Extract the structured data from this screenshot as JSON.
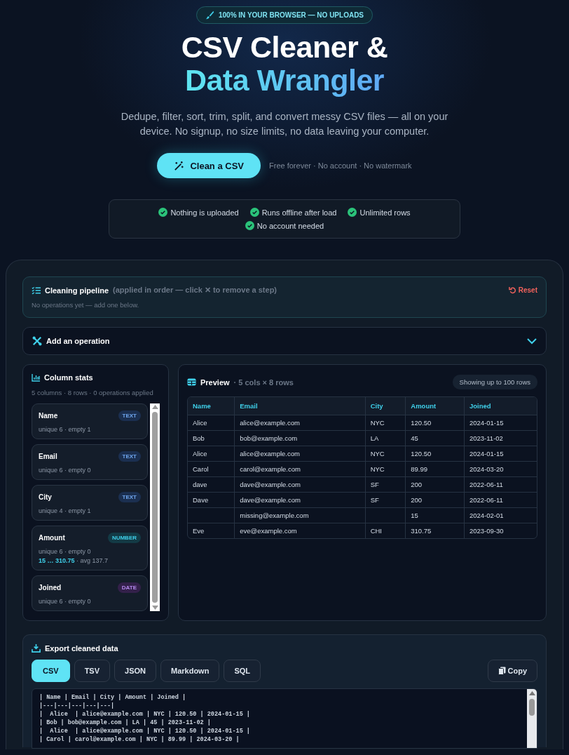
{
  "badge": {
    "text": "100% IN YOUR BROWSER — NO UPLOADS"
  },
  "hero": {
    "title_line_1": "CSV Cleaner &",
    "title_line_2": "Data Wrangler",
    "subtitle": "Dedupe, filter, sort, trim, split, and convert messy CSV files — all on your device. No signup, no size limits, no data leaving your computer.",
    "cta": "Clean a CSV",
    "note": "Free forever · No account · No watermark"
  },
  "features": [
    "Nothing is uploaded",
    "Runs offline after load",
    "Unlimited rows",
    "No account needed"
  ],
  "pipeline": {
    "title": "Cleaning pipeline",
    "hint": "(applied in order — click ✕ to remove a step)",
    "reset": "Reset",
    "empty_text": "No operations yet — add one below."
  },
  "add_operation": {
    "label": "Add an operation",
    "expanded": false
  },
  "column_stats": {
    "title": "Column stats",
    "summary": "5 columns · 8 rows · 0 operations applied",
    "columns": [
      {
        "name": "Name",
        "type": "TEXT",
        "kind": "text",
        "stats": "unique 6 · empty 1"
      },
      {
        "name": "Email",
        "type": "TEXT",
        "kind": "text",
        "stats": "unique 6 · empty 0"
      },
      {
        "name": "City",
        "type": "TEXT",
        "kind": "text",
        "stats": "unique 4 · empty 1"
      },
      {
        "name": "Amount",
        "type": "NUMBER",
        "kind": "number",
        "stats": "unique 6 · empty 0",
        "range": "15 … 310.75",
        "avg": "· avg 137.7"
      },
      {
        "name": "Joined",
        "type": "DATE",
        "kind": "date",
        "stats": "unique 6 · empty 0"
      }
    ]
  },
  "preview": {
    "title": "Preview",
    "meta": "· 5 cols × 8 rows",
    "badge": "Showing up to 100 rows",
    "columns": [
      "Name",
      "Email",
      "City",
      "Amount",
      "Joined"
    ],
    "rows": [
      [
        "Alice",
        "alice@example.com",
        "NYC",
        "120.50",
        "2024-01-15"
      ],
      [
        "Bob",
        "bob@example.com",
        "LA",
        "45",
        "2023-11-02"
      ],
      [
        "Alice",
        "alice@example.com",
        "NYC",
        "120.50",
        "2024-01-15"
      ],
      [
        "Carol",
        "carol@example.com",
        "NYC",
        "89.99",
        "2024-03-20"
      ],
      [
        "dave",
        "dave@example.com",
        "SF",
        "200",
        "2022-06-11"
      ],
      [
        "Dave",
        "dave@example.com",
        "SF",
        "200",
        "2022-06-11"
      ],
      [
        "",
        "missing@example.com",
        "",
        "15",
        "2024-02-01"
      ],
      [
        "Eve",
        "eve@example.com",
        "CHI",
        "310.75",
        "2023-09-30"
      ]
    ]
  },
  "export": {
    "title": "Export cleaned data",
    "formats": [
      {
        "label": "CSV",
        "selected": true
      },
      {
        "label": "TSV",
        "selected": false
      },
      {
        "label": "JSON",
        "selected": false
      },
      {
        "label": "Markdown",
        "selected": false
      },
      {
        "label": "SQL",
        "selected": false
      }
    ],
    "copy": "Copy",
    "output_lines": [
      "| Name | Email | City | Amount | Joined |",
      "|---|---|---|---|---|",
      "|  Alice  | alice@example.com | NYC | 120.50 | 2024-01-15 |",
      "| Bob | bob@example.com | LA | 45 | 2023-11-02 |",
      "|  Alice  | alice@example.com | NYC | 120.50 | 2024-01-15 |",
      "| Carol | carol@example.com | NYC | 89.99 | 2024-03-20 |"
    ]
  }
}
